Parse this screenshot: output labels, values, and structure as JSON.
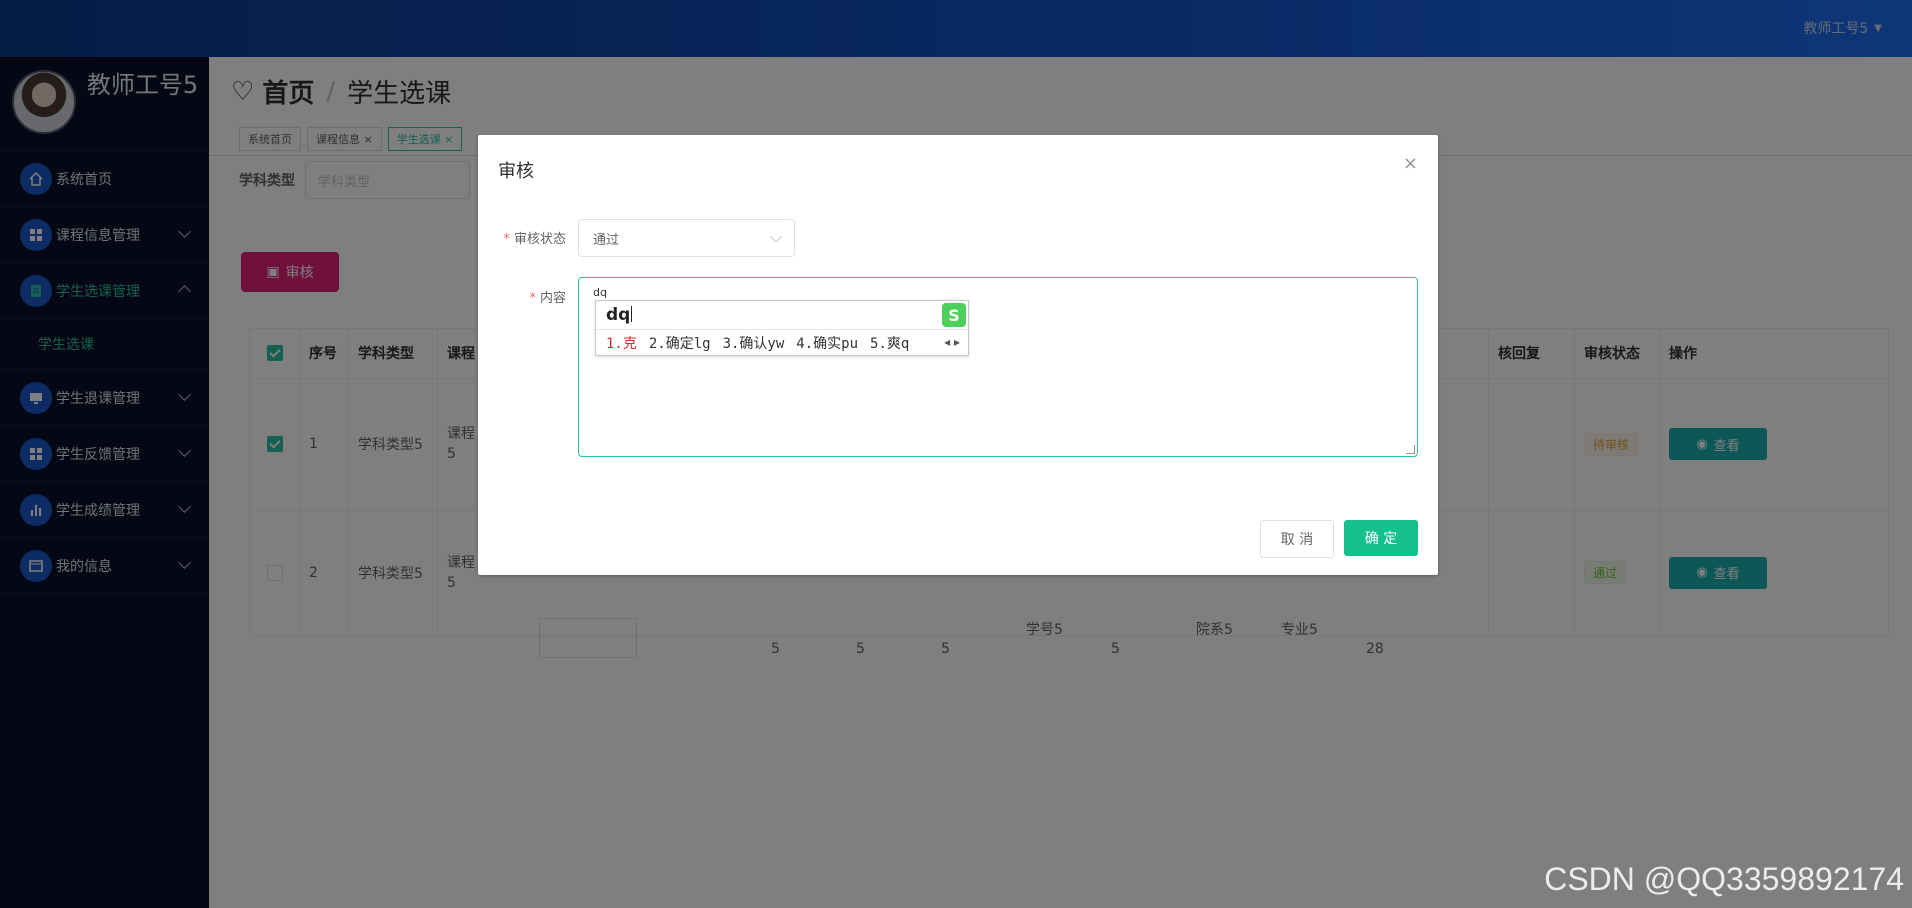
{
  "header": {
    "user_label": "教师工号5"
  },
  "sidebar": {
    "profile_name": "教师工号5",
    "items": [
      {
        "label": "系统首页"
      },
      {
        "label": "课程信息管理"
      },
      {
        "label": "学生选课管理"
      },
      {
        "label": "学生退课管理"
      },
      {
        "label": "学生反馈管理"
      },
      {
        "label": "学生成绩管理"
      },
      {
        "label": "我的信息"
      }
    ],
    "submenu_item": "学生选课"
  },
  "breadcrumb": {
    "home": "首页",
    "separator": "/",
    "current": "学生选课"
  },
  "tabs": [
    {
      "label": "系统首页"
    },
    {
      "label": "课程信息 ×"
    },
    {
      "label": "学生选课 ×"
    }
  ],
  "filter": {
    "label": "学科类型",
    "placeholder": "学科类型"
  },
  "toolbar": {
    "audit_label": "审核"
  },
  "table": {
    "headers": [
      "序号",
      "学科类型",
      "课程",
      "核回复",
      "审核状态",
      "操作"
    ],
    "rows": [
      {
        "index": "1",
        "type": "学科类型5",
        "course": "课程\n5",
        "status": "待审核",
        "action": "查看"
      },
      {
        "index": "2",
        "type": "学科类型5",
        "course": "课程\n5",
        "status": "通过",
        "action": "查看",
        "c1": "5",
        "c2": "5",
        "c3": "5",
        "c4": "学号5",
        "c5": "5",
        "c6": "院系5",
        "c7": "专业5",
        "c8": "28"
      }
    ]
  },
  "dialog": {
    "title": "审核",
    "close": "×",
    "status_label": "审核状态",
    "status_value": "通过",
    "content_label": "内容",
    "content_value": "dq",
    "ime": {
      "composition": "dq",
      "candidates": [
        "1.克",
        "2.确定lg",
        "3.确认yw",
        "4.确实pu",
        "5.爽q"
      ],
      "logo": "S",
      "nav": "◂ ▸"
    },
    "cancel_label": "取 消",
    "ok_label": "确 定"
  },
  "watermark": "CSDN @QQ3359892174",
  "colors": {
    "accent": "#2bc2a2",
    "audit_button": "#e0217a",
    "ok_button": "#14c08c",
    "sidebar_bg": "#0b0f2a",
    "topbar": "#1052c4"
  }
}
